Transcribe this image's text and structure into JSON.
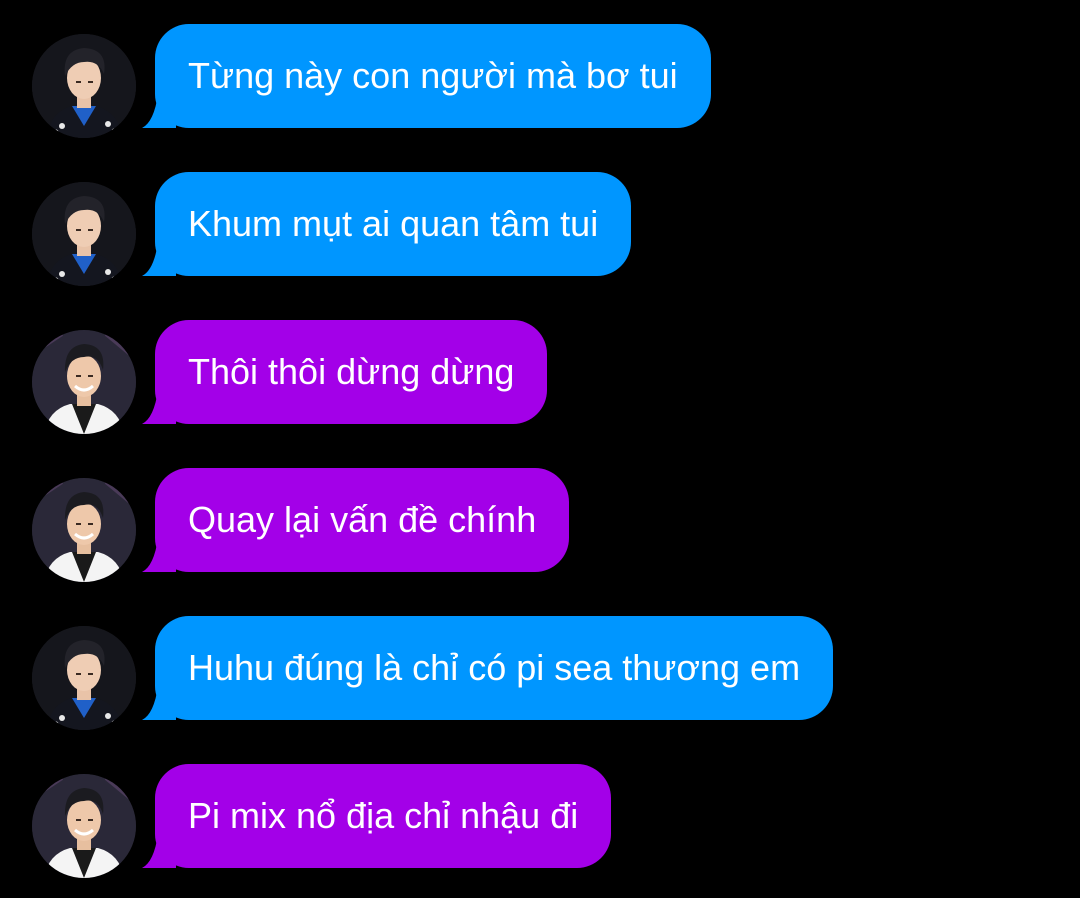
{
  "colors": {
    "background": "#000000",
    "bubble_blue": "#0096FF",
    "bubble_purple": "#A300E8",
    "text": "#FFFFFF"
  },
  "messages": [
    {
      "sender": "avatar-a",
      "bubble": "blue",
      "text": "Từng này con người mà bơ tui"
    },
    {
      "sender": "avatar-a",
      "bubble": "blue",
      "text": "Khum mụt ai quan tâm tui"
    },
    {
      "sender": "avatar-b",
      "bubble": "purple",
      "text": "Thôi thôi dừng dừng"
    },
    {
      "sender": "avatar-b",
      "bubble": "purple",
      "text": "Quay lại vấn đề chính"
    },
    {
      "sender": "avatar-a",
      "bubble": "blue",
      "text": "Huhu đúng là chỉ có pi sea thương em"
    },
    {
      "sender": "avatar-b",
      "bubble": "purple",
      "text": "Pi mix nổ địa chỉ nhậu đi"
    }
  ]
}
